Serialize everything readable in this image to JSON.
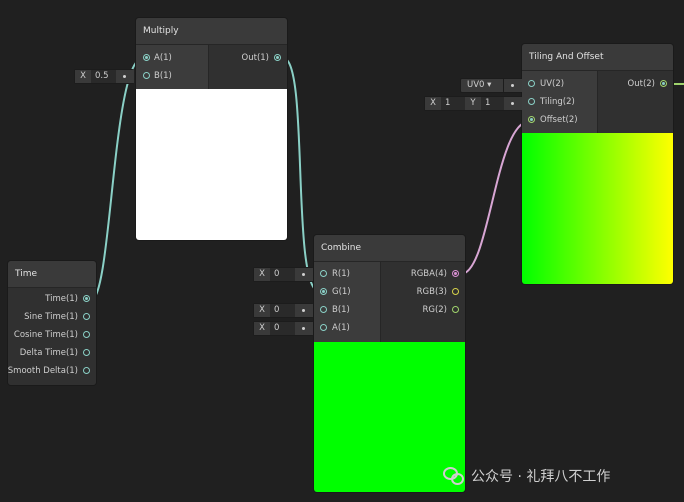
{
  "multiply": {
    "title": "Multiply",
    "inputs": [
      "A(1)",
      "B(1)"
    ],
    "outputs": [
      "Out(1)"
    ],
    "b_field": {
      "axis": "X",
      "value": "0.5"
    },
    "preview_color": "#ffffff"
  },
  "tiling": {
    "title": "Tiling And Offset",
    "inputs": [
      "UV(2)",
      "Tiling(2)",
      "Offset(2)"
    ],
    "outputs": [
      "Out(2)"
    ],
    "uv_dropdown": "UV0 ▾",
    "tiling_x": {
      "axis": "X",
      "value": "1"
    },
    "tiling_y": {
      "axis": "Y",
      "value": "1"
    },
    "preview_gradient": [
      "#00ff00",
      "#ffff00"
    ]
  },
  "time": {
    "title": "Time",
    "outputs": [
      "Time(1)",
      "Sine Time(1)",
      "Cosine Time(1)",
      "Delta Time(1)",
      "Smooth Delta(1)"
    ]
  },
  "combine": {
    "title": "Combine",
    "inputs": [
      "R(1)",
      "G(1)",
      "B(1)",
      "A(1)"
    ],
    "outputs": [
      "RGBA(4)",
      "RGB(3)",
      "RG(2)"
    ],
    "r_field": {
      "axis": "X",
      "value": "0"
    },
    "b_field": {
      "axis": "X",
      "value": "0"
    },
    "a_field": {
      "axis": "X",
      "value": "0"
    },
    "preview_color": "#00ff00"
  },
  "watermark": {
    "text": "公众号 · 礼拜八不工作"
  },
  "colors": {
    "background": "#202020",
    "float_wire": "#8ad0c6",
    "vector4_wire": "#d88fd2",
    "vector2_wire": "#9fd36c"
  }
}
